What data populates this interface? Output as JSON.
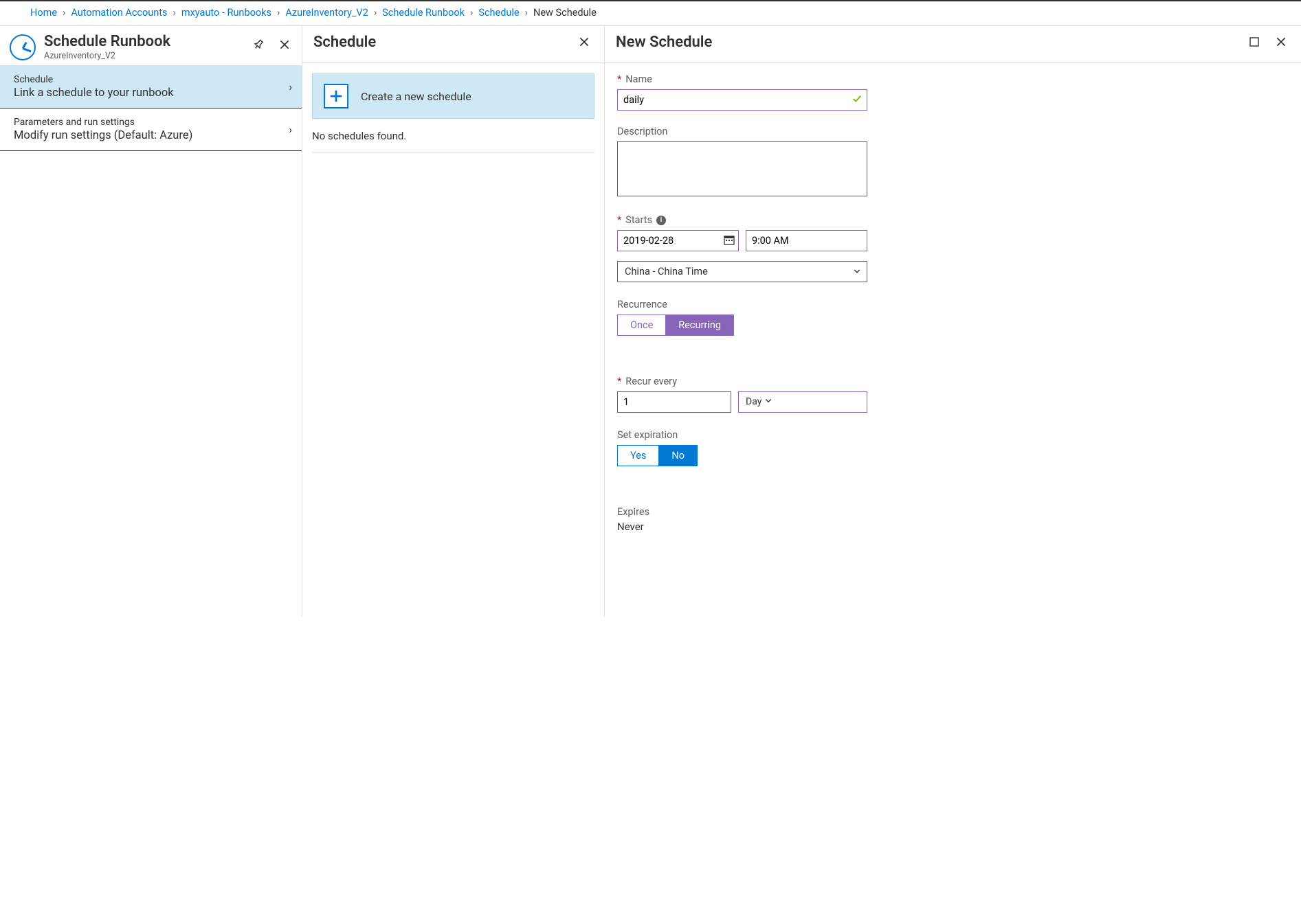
{
  "breadcrumb": {
    "items": [
      "Home",
      "Automation Accounts",
      "mxyauto - Runbooks",
      "AzureInventory_V2",
      "Schedule Runbook",
      "Schedule"
    ],
    "current": "New Schedule"
  },
  "panel1": {
    "title": "Schedule Runbook",
    "subtitle": "AzureInventory_V2",
    "items": [
      {
        "label": "Schedule",
        "desc": "Link a schedule to your runbook",
        "selected": true
      },
      {
        "label": "Parameters and run settings",
        "desc": "Modify run settings (Default: Azure)",
        "selected": false
      }
    ]
  },
  "panel2": {
    "title": "Schedule",
    "create_label": "Create a new schedule",
    "empty_text": "No schedules found."
  },
  "panel3": {
    "title": "New Schedule",
    "form": {
      "name_label": "Name",
      "name_value": "daily",
      "description_label": "Description",
      "description_value": "",
      "starts_label": "Starts",
      "starts_date": "2019-02-28",
      "starts_time": "9:00 AM",
      "timezone": "China - China Time",
      "recurrence_label": "Recurrence",
      "recurrence_options": [
        "Once",
        "Recurring"
      ],
      "recurrence_selected": "Recurring",
      "recur_every_label": "Recur every",
      "recur_every_value": "1",
      "recur_every_unit": "Day",
      "set_expiration_label": "Set expiration",
      "set_expiration_options": [
        "Yes",
        "No"
      ],
      "set_expiration_selected": "No",
      "expires_label": "Expires",
      "expires_value": "Never"
    }
  }
}
